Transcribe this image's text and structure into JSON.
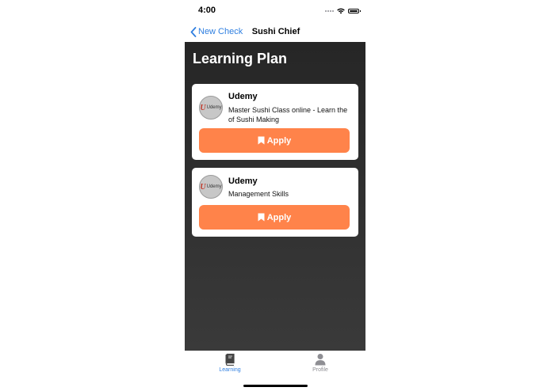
{
  "status_bar": {
    "time": "4:00"
  },
  "nav": {
    "back_label": "New Check",
    "title": "Sushi Chief"
  },
  "page": {
    "title": "Learning Plan"
  },
  "cards": [
    {
      "logo_text": "Udemy",
      "provider": "Udemy",
      "description_line1": "Master Sushi Class online - Learn the",
      "description_line2": "of Sushi Making",
      "button_label": "Apply"
    },
    {
      "logo_text": "Udemy",
      "provider": "Udemy",
      "description_line1": "Management Skills",
      "button_label": "Apply"
    }
  ],
  "tabs": [
    {
      "label": "Learning",
      "icon": "book-icon",
      "active": true
    },
    {
      "label": "Profile",
      "icon": "person-icon",
      "active": false
    }
  ],
  "colors": {
    "accent": "#2f7fe0",
    "apply_button": "#ff834a",
    "content_background_top": "#262626",
    "content_background_bottom": "#3a3a3a"
  }
}
